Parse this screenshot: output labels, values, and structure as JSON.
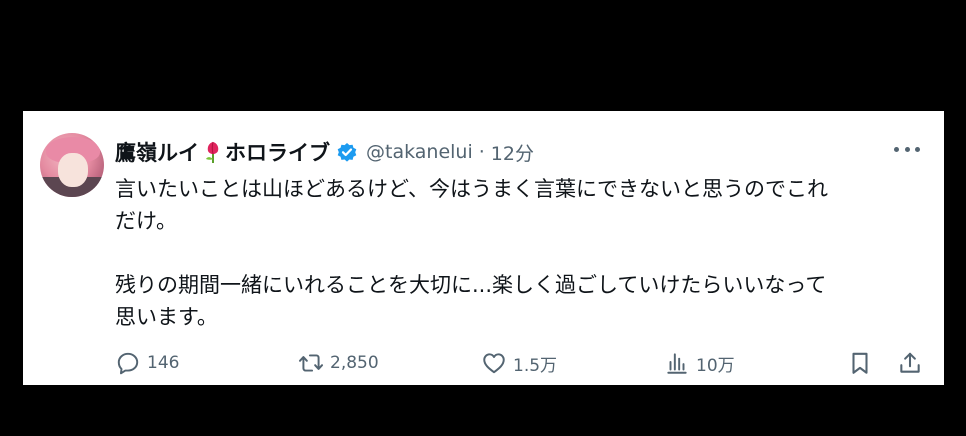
{
  "tweet": {
    "author_name": "鷹嶺ルイ",
    "author_org": "ホロライブ",
    "handle": "@takanelui",
    "separator": "·",
    "time": "12分",
    "text_lines": [
      "言いたいことは山ほどあるけど、今はうまく言葉にできないと思うのでこれ",
      "だけ。",
      "",
      "残りの期間一緒にいれることを大切に...楽しく過ごしていけたらいいなって",
      "思います。"
    ],
    "verified_color": "#1d9bf0",
    "icons": {
      "flower": "tulip-flower-icon",
      "verified": "verified-badge-icon",
      "more": "more-icon"
    }
  },
  "actions": {
    "reply": {
      "icon": "reply-icon",
      "count": "146"
    },
    "retweet": {
      "icon": "retweet-icon",
      "count": "2,850"
    },
    "like": {
      "icon": "heart-icon",
      "count": "1.5万"
    },
    "views": {
      "icon": "views-icon",
      "count": "10万"
    },
    "bookmark": {
      "icon": "bookmark-icon"
    },
    "share": {
      "icon": "share-icon"
    }
  }
}
